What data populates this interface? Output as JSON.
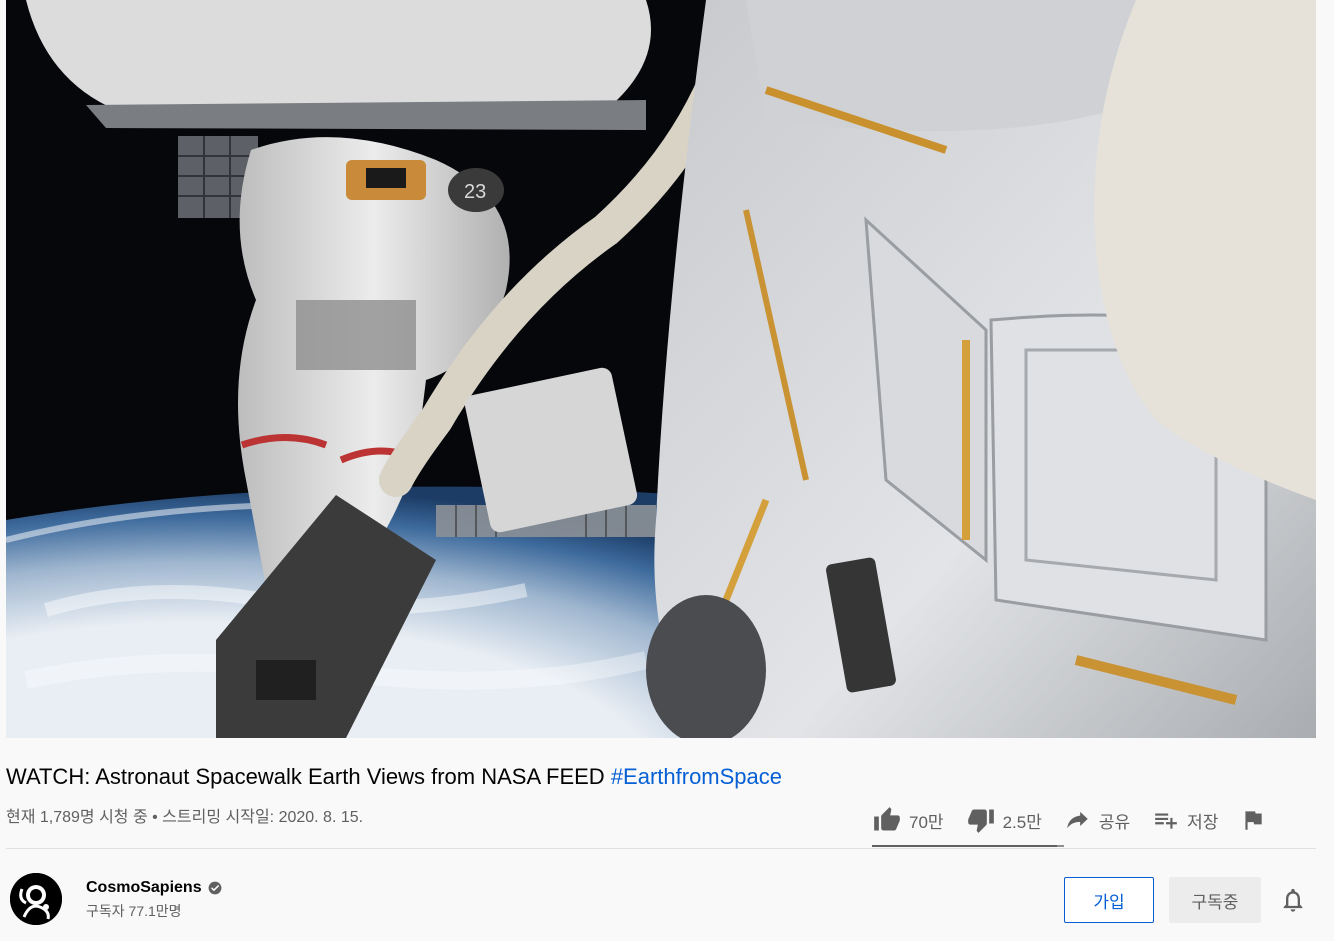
{
  "video": {
    "title": "WATCH: Astronaut Spacewalk Earth Views from NASA FEED",
    "hashtag": "#EarthfromSpace",
    "info": "현재 1,789명 시청 중 • 스트리밍 시작일: 2020. 8. 15."
  },
  "actions": {
    "like_count": "70만",
    "dislike_count": "2.5만",
    "share_label": "공유",
    "save_label": "저장",
    "like_ratio": 0.966
  },
  "channel": {
    "name": "CosmoSapiens",
    "subscribers": "구독자 77.1만명",
    "verified": true
  },
  "buttons": {
    "join": "가입",
    "subscribed": "구독중"
  },
  "colors": {
    "link_blue": "#065fd4",
    "text_secondary": "#606060",
    "background": "#f9f9f9"
  },
  "icons": [
    "like-icon",
    "dislike-icon",
    "share-icon",
    "save-playlist-icon",
    "report-flag-icon",
    "verified-icon",
    "notification-bell-icon"
  ]
}
